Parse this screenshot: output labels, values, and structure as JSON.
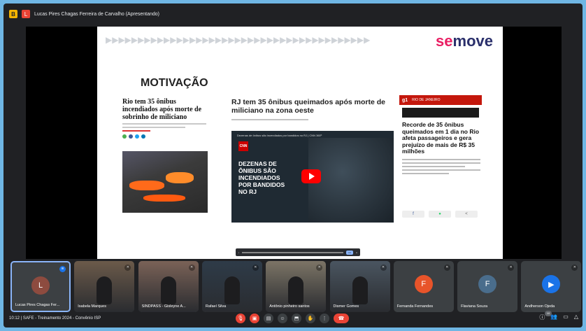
{
  "window": {
    "presenter_label": "Lucas Pires Chagas Ferreira de Carvalho (Apresentando)",
    "app_badge": "B",
    "presenter_initial": "L"
  },
  "slide": {
    "arrows": "▶▶▶▶▶▶▶▶▶▶▶▶▶▶▶▶▶▶▶▶▶▶▶▶▶▶▶▶▶▶▶▶▶▶▶▶▶▶▶▶▶",
    "logo_prefix": "se",
    "logo_rest": "move",
    "title": "MOTIVAÇÃO",
    "article1_headline": "Rio tem 35 ônibus incendiados após morte de sobrinho de miliciano",
    "article2_headline": "RJ tem 35 ônibus queimados após morte de miliciano na zona oeste",
    "video_caption": "Dezenas de ônibus são incendiados por bandidos no RJ | CNN 360º",
    "video_brand": "CNN",
    "video_overlay": "DEZENAS DE ÔNIBUS SÃO INCENDIADOS POR BANDIDOS NO RJ",
    "g1_brand": "g1",
    "g1_region": "RIO DE JANEIRO",
    "article3_headline": "Recorde de 35 ônibus queimados em 1 dia no Rio afeta passageiros e gera prejuízo de mais de R$ 35 milhões",
    "colors": {
      "accent": "#e91e63",
      "g1_red": "#c4170c",
      "brand_navy": "#2a2f6b"
    }
  },
  "participants": [
    {
      "name": "Lucas Pires Chagas Fer...",
      "initial": "L",
      "color": "#8d4b3f",
      "active": true,
      "type": "avatar"
    },
    {
      "name": "Isabela Marques",
      "type": "video",
      "color": "#6b5a4a"
    },
    {
      "name": "SINDPASS - Gisleyne A...",
      "type": "video",
      "color": "#7a6257"
    },
    {
      "name": "Rafael Silva",
      "type": "video",
      "color": "#2e3b48"
    },
    {
      "name": "Antônio pinheiro santos",
      "type": "video",
      "color": "#7c7466"
    },
    {
      "name": "Dismer Gomes",
      "type": "video",
      "color": "#4a5560"
    },
    {
      "name": "Fernanda Fernandes",
      "initial": "F",
      "color": "#e8542a",
      "type": "avatar"
    },
    {
      "name": "Flaviana Souza",
      "initial": "F",
      "color": "#4a6d8c",
      "type": "avatar"
    },
    {
      "name": "Andherson Ojeda",
      "initial": "▶",
      "color": "#1a73e8",
      "type": "avatar"
    }
  ],
  "bottom": {
    "meeting": "10:12 | SAFE - Treinamento 2024 - Convênio ISP",
    "participant_count": "10"
  }
}
